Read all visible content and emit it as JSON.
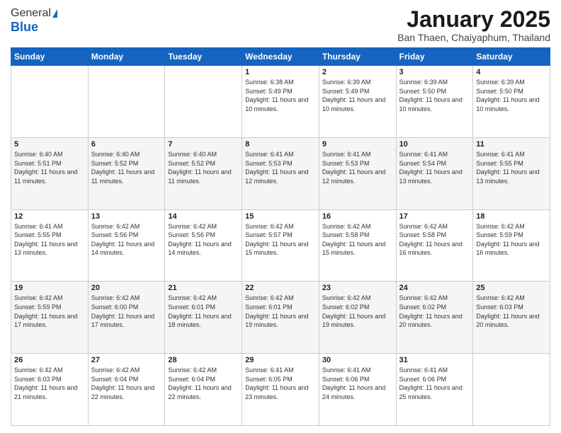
{
  "logo": {
    "general": "General",
    "blue": "Blue"
  },
  "header": {
    "month": "January 2025",
    "location": "Ban Thaen, Chaiyaphum, Thailand"
  },
  "days_of_week": [
    "Sunday",
    "Monday",
    "Tuesday",
    "Wednesday",
    "Thursday",
    "Friday",
    "Saturday"
  ],
  "weeks": [
    [
      {
        "day": "",
        "info": ""
      },
      {
        "day": "",
        "info": ""
      },
      {
        "day": "",
        "info": ""
      },
      {
        "day": "1",
        "info": "Sunrise: 6:38 AM\nSunset: 5:49 PM\nDaylight: 11 hours and 10 minutes."
      },
      {
        "day": "2",
        "info": "Sunrise: 6:39 AM\nSunset: 5:49 PM\nDaylight: 11 hours and 10 minutes."
      },
      {
        "day": "3",
        "info": "Sunrise: 6:39 AM\nSunset: 5:50 PM\nDaylight: 11 hours and 10 minutes."
      },
      {
        "day": "4",
        "info": "Sunrise: 6:39 AM\nSunset: 5:50 PM\nDaylight: 11 hours and 10 minutes."
      }
    ],
    [
      {
        "day": "5",
        "info": "Sunrise: 6:40 AM\nSunset: 5:51 PM\nDaylight: 11 hours and 11 minutes."
      },
      {
        "day": "6",
        "info": "Sunrise: 6:40 AM\nSunset: 5:52 PM\nDaylight: 11 hours and 11 minutes."
      },
      {
        "day": "7",
        "info": "Sunrise: 6:40 AM\nSunset: 5:52 PM\nDaylight: 11 hours and 11 minutes."
      },
      {
        "day": "8",
        "info": "Sunrise: 6:41 AM\nSunset: 5:53 PM\nDaylight: 11 hours and 12 minutes."
      },
      {
        "day": "9",
        "info": "Sunrise: 6:41 AM\nSunset: 5:53 PM\nDaylight: 11 hours and 12 minutes."
      },
      {
        "day": "10",
        "info": "Sunrise: 6:41 AM\nSunset: 5:54 PM\nDaylight: 11 hours and 13 minutes."
      },
      {
        "day": "11",
        "info": "Sunrise: 6:41 AM\nSunset: 5:55 PM\nDaylight: 11 hours and 13 minutes."
      }
    ],
    [
      {
        "day": "12",
        "info": "Sunrise: 6:41 AM\nSunset: 5:55 PM\nDaylight: 11 hours and 13 minutes."
      },
      {
        "day": "13",
        "info": "Sunrise: 6:42 AM\nSunset: 5:56 PM\nDaylight: 11 hours and 14 minutes."
      },
      {
        "day": "14",
        "info": "Sunrise: 6:42 AM\nSunset: 5:56 PM\nDaylight: 11 hours and 14 minutes."
      },
      {
        "day": "15",
        "info": "Sunrise: 6:42 AM\nSunset: 5:57 PM\nDaylight: 11 hours and 15 minutes."
      },
      {
        "day": "16",
        "info": "Sunrise: 6:42 AM\nSunset: 5:58 PM\nDaylight: 11 hours and 15 minutes."
      },
      {
        "day": "17",
        "info": "Sunrise: 6:42 AM\nSunset: 5:58 PM\nDaylight: 11 hours and 16 minutes."
      },
      {
        "day": "18",
        "info": "Sunrise: 6:42 AM\nSunset: 5:59 PM\nDaylight: 11 hours and 16 minutes."
      }
    ],
    [
      {
        "day": "19",
        "info": "Sunrise: 6:42 AM\nSunset: 5:59 PM\nDaylight: 11 hours and 17 minutes."
      },
      {
        "day": "20",
        "info": "Sunrise: 6:42 AM\nSunset: 6:00 PM\nDaylight: 11 hours and 17 minutes."
      },
      {
        "day": "21",
        "info": "Sunrise: 6:42 AM\nSunset: 6:01 PM\nDaylight: 11 hours and 18 minutes."
      },
      {
        "day": "22",
        "info": "Sunrise: 6:42 AM\nSunset: 6:01 PM\nDaylight: 11 hours and 19 minutes."
      },
      {
        "day": "23",
        "info": "Sunrise: 6:42 AM\nSunset: 6:02 PM\nDaylight: 11 hours and 19 minutes."
      },
      {
        "day": "24",
        "info": "Sunrise: 6:42 AM\nSunset: 6:02 PM\nDaylight: 11 hours and 20 minutes."
      },
      {
        "day": "25",
        "info": "Sunrise: 6:42 AM\nSunset: 6:03 PM\nDaylight: 11 hours and 20 minutes."
      }
    ],
    [
      {
        "day": "26",
        "info": "Sunrise: 6:42 AM\nSunset: 6:03 PM\nDaylight: 11 hours and 21 minutes."
      },
      {
        "day": "27",
        "info": "Sunrise: 6:42 AM\nSunset: 6:04 PM\nDaylight: 11 hours and 22 minutes."
      },
      {
        "day": "28",
        "info": "Sunrise: 6:42 AM\nSunset: 6:04 PM\nDaylight: 11 hours and 22 minutes."
      },
      {
        "day": "29",
        "info": "Sunrise: 6:41 AM\nSunset: 6:05 PM\nDaylight: 11 hours and 23 minutes."
      },
      {
        "day": "30",
        "info": "Sunrise: 6:41 AM\nSunset: 6:06 PM\nDaylight: 11 hours and 24 minutes."
      },
      {
        "day": "31",
        "info": "Sunrise: 6:41 AM\nSunset: 6:06 PM\nDaylight: 11 hours and 25 minutes."
      },
      {
        "day": "",
        "info": ""
      }
    ]
  ]
}
